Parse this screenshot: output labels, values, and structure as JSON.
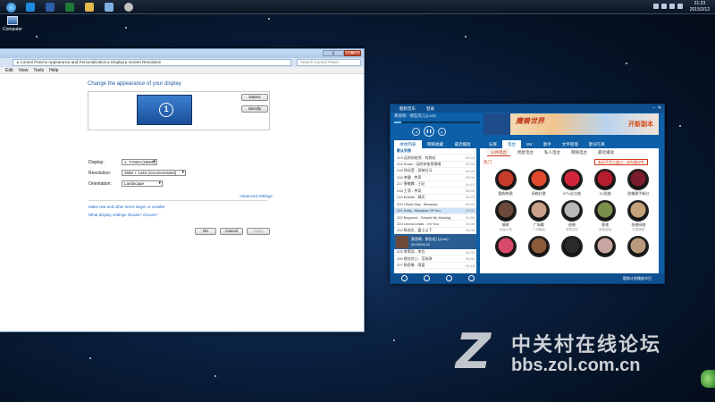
{
  "taskbar": {
    "clock_time": "21:23",
    "clock_date": "2015/2/12",
    "tray_lang": "CH"
  },
  "desktop": {
    "computer_label": "Computer"
  },
  "control_panel": {
    "address": "▸ Control Panel ▸ Appearance and Personalization ▸ Display ▸ Screen Resolution",
    "search_placeholder": "Search Control Panel",
    "menu": [
      "Edit",
      "View",
      "Tools",
      "Help"
    ],
    "heading": "Change the appearance of your display",
    "monitor_number": "1",
    "detect_label": "Detect",
    "identify_label": "Identify",
    "display_label": "Display:",
    "display_value": "1. T7000+(HDMI)",
    "resolution_label": "Resolution:",
    "resolution_value": "2560 × 1440 (recommended)",
    "orientation_label": "Orientation:",
    "orientation_value": "Landscape",
    "advanced_link": "Advanced settings",
    "link_text_size": "Make text and other items larger or smaller",
    "link_display_settings": "What display settings should I choose?",
    "ok_label": "OK",
    "cancel_label": "Cancel",
    "apply_label": "Apply"
  },
  "music_player": {
    "title": "酷狗音乐",
    "title_extra": "登录",
    "now_playing": "黄昏晓 - 那些花儿(Live)",
    "progress": 0.08,
    "banner_text": "魔兽世界",
    "banner_right": "开新副本",
    "left_tabs": [
      "本地列表",
      "网络收藏",
      "最近播放"
    ],
    "playlist": [
      {
        "name": "默认列表",
        "dur": "",
        "group": true
      },
      {
        "name": "213 远的你依然 - 何其钦",
        "dur": "04:24"
      },
      {
        "name": "214 Snow - 远的你依然演唱",
        "dur": "05:03"
      },
      {
        "name": "215 徐佳莹 - 身骑白马",
        "dur": "04:45"
      },
      {
        "name": "216 李健 - 传奇",
        "dur": "05:00"
      },
      {
        "name": "217 萧敬腾 - 王妃",
        "dur": "04:10"
      },
      {
        "name": "218 王菲 - 传奇",
        "dur": "05:02"
      },
      {
        "name": "219 Bubble - 晴天",
        "dur": "04:29"
      },
      {
        "name": "220 Olivia Ong - Because",
        "dur": "04:02"
      },
      {
        "name": "221 Kelly - Because Of You",
        "dur": "03:39"
      },
      {
        "name": "222 Beyonce - Should Be Missing",
        "dur": "04:50"
      },
      {
        "name": "223 Leona Lewis - I'm You",
        "dur": "03:48"
      },
      {
        "name": "224 陈奕迅 - 富士山下",
        "dur": "04:05"
      }
    ],
    "selected_index": 9,
    "now_card": "黄昏晓 - 那些花儿(Live)",
    "now_card_time": "00:00/04:22",
    "playlist_after": [
      {
        "name": "225 李荣浩 - 李白",
        "dur": "04:34"
      },
      {
        "name": "226 那些花儿 - 范玮琪",
        "dur": "04:32"
      },
      {
        "name": "227 杨丞琳 - 雨爱",
        "dur": "04:16"
      }
    ],
    "nav": [
      "乐库",
      "电台",
      "MV",
      "歌手",
      "文件管理",
      "歌词写真"
    ],
    "nav_active": 1,
    "subnav": [
      "公共电台",
      "明星电台",
      "私人电台",
      "网络电台",
      "最近播放"
    ],
    "subnav_active": 0,
    "hot_label": "热门",
    "promo": "有好声音大盒点，给你最好的",
    "stations": [
      {
        "name": "酷狗热歌",
        "sub": ""
      },
      {
        "name": "网络红歌",
        "sub": ""
      },
      {
        "name": "KTV必点曲",
        "sub": ""
      },
      {
        "name": "DJ劲曲",
        "sub": ""
      },
      {
        "name": "欧美歌手新红",
        "sub": ""
      },
      {
        "name": "情歌",
        "sub": "浪漫乡情"
      },
      {
        "name": "广场舞",
        "sub": "广场舞曲"
      },
      {
        "name": "经典",
        "sub": "老歌回忆"
      },
      {
        "name": "影视",
        "sub": "影视金曲"
      },
      {
        "name": "伤感网络",
        "sub": "伤感情歌"
      },
      {
        "name": "",
        "sub": ""
      },
      {
        "name": "",
        "sub": ""
      },
      {
        "name": "",
        "sub": ""
      },
      {
        "name": "",
        "sub": ""
      },
      {
        "name": "",
        "sub": ""
      }
    ],
    "status": "酷狗计划播放节目",
    "station_colors": [
      "#c73b2a",
      "#e24a2f",
      "#d1253c",
      "#b81d2f",
      "#7a1c2c",
      "#6b4a3a",
      "#caa18a",
      "#b8b8b8",
      "#7b8f4a",
      "#c5a27a",
      "#d94a6a",
      "#8a5a3a",
      "#2a2a2a",
      "#c7a5a0",
      "#b89a7a"
    ]
  },
  "watermark": {
    "logo": "Z",
    "cn": "中关村在线论坛",
    "url": "bbs.zol.com.cn"
  }
}
